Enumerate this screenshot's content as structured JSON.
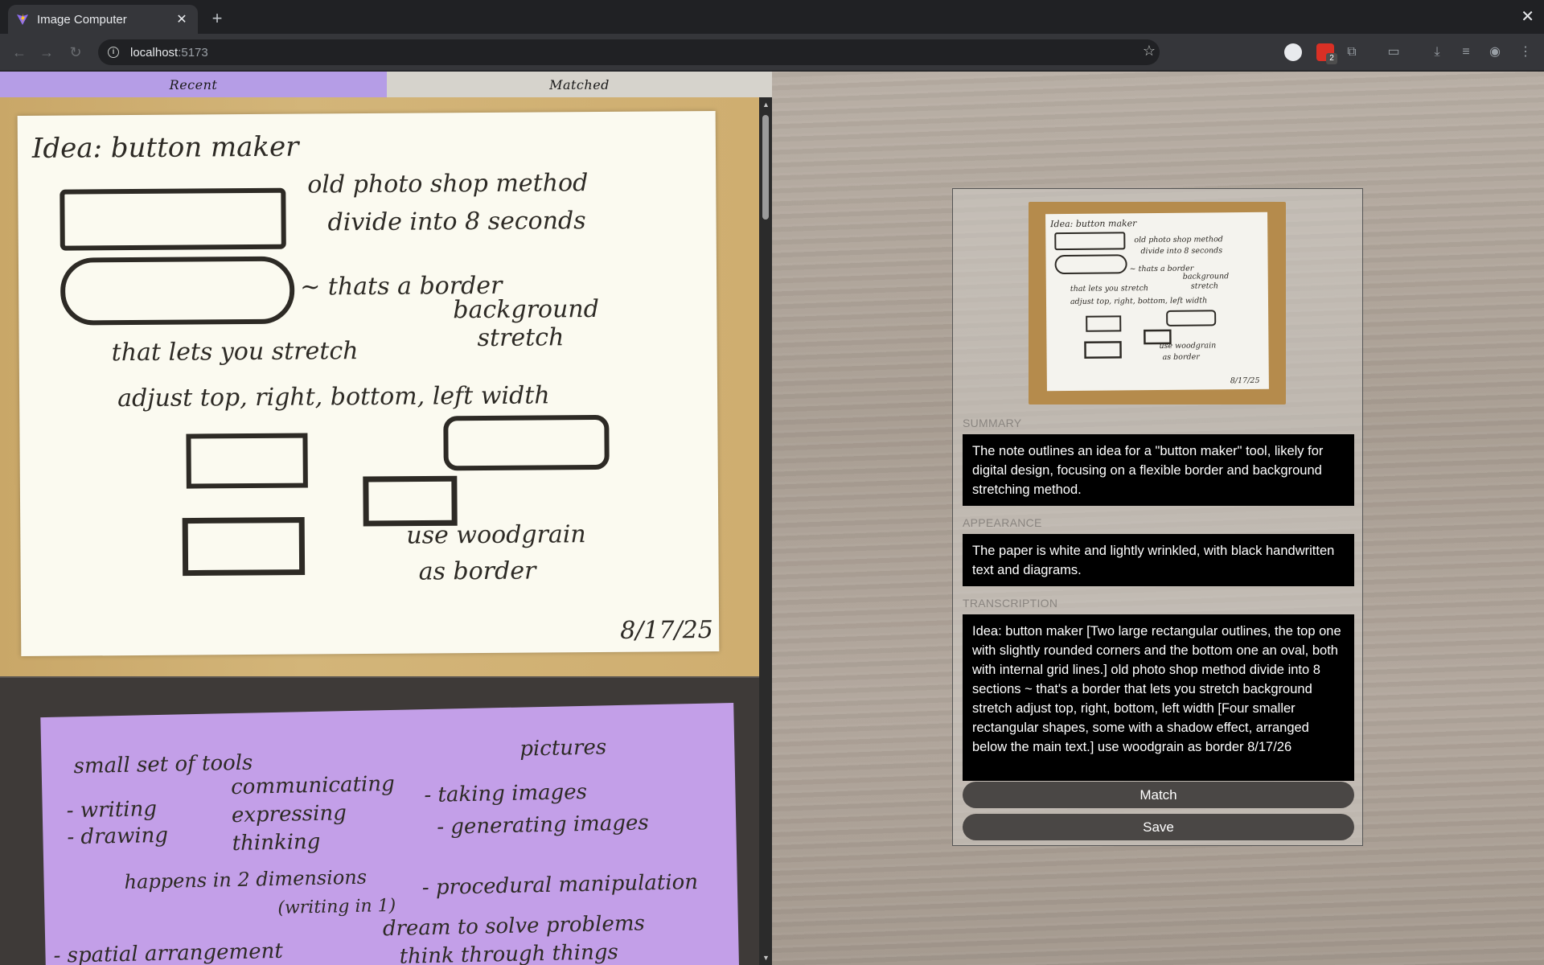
{
  "browser": {
    "tab_title": "Image Computer",
    "new_tab_symbol": "+",
    "close_symbol": "✕",
    "url_host": "localhost",
    "url_port": ":5173",
    "extension_badge": "2"
  },
  "app": {
    "tabs": [
      {
        "label": "Recent",
        "active": true
      },
      {
        "label": "Matched",
        "active": false
      }
    ],
    "active_tab_color": "#b59de6",
    "inactive_tab_color": "#d6d3cc"
  },
  "notes": {
    "first": {
      "title": "Idea: button maker",
      "lines": [
        "old photo shop method",
        "divide into 8 seconds",
        "~ thats a border",
        "that lets you stretch",
        "background",
        "stretch",
        "adjust top, right, bottom, left width",
        "use woodgrain",
        "as border"
      ],
      "date": "8/17/25"
    },
    "second": {
      "lines": [
        "small set of tools",
        "pictures",
        "communicating",
        "- writing",
        "- drawing",
        "expressing",
        "thinking",
        "- taking images",
        "- generating images",
        "happens in 2 dimensions",
        "(writing in 1)",
        "- procedural manipulation",
        "- spatial arrangement",
        "dream to solve problems",
        "think through things"
      ]
    }
  },
  "detail": {
    "summary_label": "SUMMARY",
    "summary_text": "The note outlines an idea for a \"button maker\" tool, likely for digital design, focusing on a flexible border and background stretching method.",
    "appearance_label": "APPEARANCE",
    "appearance_text": "The paper is white and lightly wrinkled, with black handwritten text and diagrams.",
    "transcription_label": "TRANSCRIPTION",
    "transcription_text": "Idea: button maker [Two large rectangular outlines, the top one with slightly rounded corners and the bottom one an oval, both with internal grid lines.] old photo shop method divide into 8 sections ~ that's a border that lets you stretch background stretch adjust top, right, bottom, left width [Four smaller rectangular shapes, some with a shadow effect, arranged below the main text.] use woodgrain as border 8/17/26",
    "match_label": "Match",
    "save_label": "Save",
    "preview": {
      "title": "Idea: button maker",
      "lines": [
        "old photo shop method",
        "divide into 8 seconds",
        "~ thats a border",
        "background",
        "that lets you stretch",
        "stretch",
        "adjust top, right, bottom, left width",
        "use woodgrain",
        "as border"
      ],
      "date": "8/17/25"
    }
  }
}
